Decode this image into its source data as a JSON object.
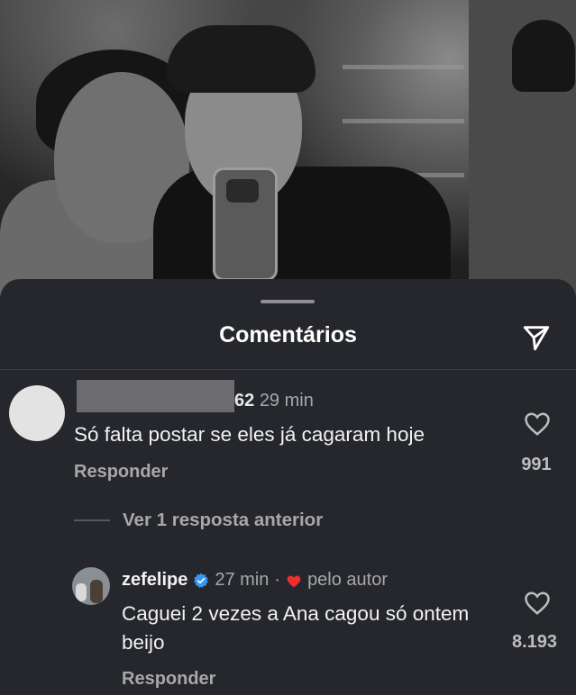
{
  "photo": {
    "description_icon": "photo-background"
  },
  "sheet": {
    "title": "Comentários",
    "share_icon": "send-icon"
  },
  "comments": [
    {
      "username_suffix": "62",
      "time": "29 min",
      "text": "Só falta postar se eles já cagaram hoje",
      "reply_label": "Responder",
      "likes": "991"
    },
    {
      "view_replies": "Ver 1 resposta anterior",
      "username": "zefelipe",
      "time": "27 min",
      "separator": "·",
      "author_label": "pelo autor",
      "text": "Caguei 2 vezes a Ana cagou só ontem beijo",
      "reply_label": "Responder",
      "likes": "8.193"
    }
  ],
  "colors": {
    "background": "#25272c",
    "verified": "#3897f0",
    "author_heart": "#ed2e2e"
  }
}
